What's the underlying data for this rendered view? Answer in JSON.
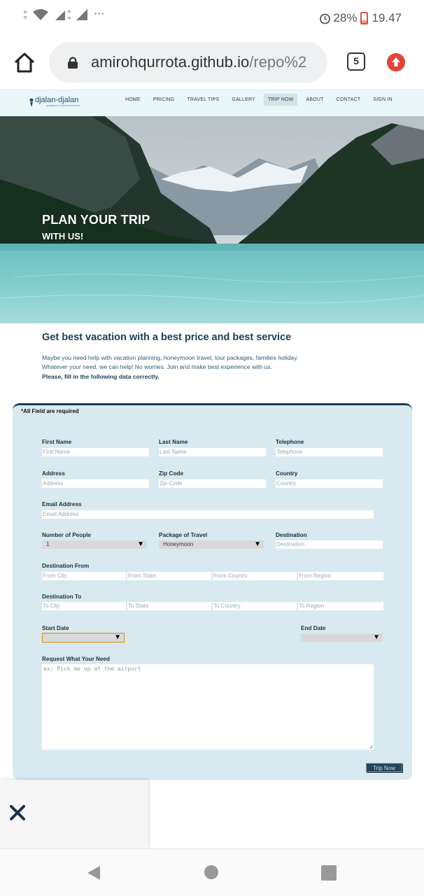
{
  "status_bar": {
    "battery": "28%",
    "time": "19.47",
    "more": "···"
  },
  "browser": {
    "url_main": "amirohqurrota.github.io",
    "url_rest": "/repo%2",
    "tab_count": "5"
  },
  "site": {
    "logo_text": "djalan-djalan",
    "logo_sub": "perjalanan & traveling bersama",
    "nav": [
      "HOME",
      "PRICING",
      "TRAVEL TIPS",
      "GALLERY",
      "TRIP NOW",
      "ABOUT",
      "CONTACT",
      "SIGN IN"
    ],
    "active_nav": "TRIP NOW"
  },
  "hero": {
    "title": "PLAN YOUR TRIP",
    "subtitle": "WITH US!"
  },
  "intro": {
    "heading": "Get best vacation with a best price and best service",
    "line1": "Maybe you need help with vacation planning, honeymoon travel, tour packages, families holiday.",
    "line2": "Whatever your need, we can help! No worries. Join and make best experience with us.",
    "line3": "Please, fill in the following data correctly."
  },
  "form": {
    "required_note": "*All Field are required",
    "first_name": {
      "label": "First Name",
      "placeholder": "First Name"
    },
    "last_name": {
      "label": "Last Name",
      "placeholder": "Last Name"
    },
    "telephone": {
      "label": "Telephone",
      "placeholder": "Telephone"
    },
    "address": {
      "label": "Address",
      "placeholder": "Address"
    },
    "zip": {
      "label": "Zip Code",
      "placeholder": "Zip Code"
    },
    "country": {
      "label": "Country",
      "placeholder": "Country"
    },
    "email": {
      "label": "Email Address",
      "placeholder": "Email Address"
    },
    "people": {
      "label": "Number of People",
      "value": "1"
    },
    "package": {
      "label": "Package of Travel",
      "value": "Honeymoon"
    },
    "destination": {
      "label": "Destination",
      "placeholder": "Destination"
    },
    "dest_from": {
      "label": "Destination From",
      "city": "From City",
      "state": "From State",
      "country": "From Country",
      "region": "From Region"
    },
    "dest_to": {
      "label": "Destination To",
      "city": "To City",
      "state": "To State",
      "country": "To Country",
      "region": "To Region"
    },
    "start_date": {
      "label": "Start Date"
    },
    "end_date": {
      "label": "End Date"
    },
    "request": {
      "label": "Request What Your Need",
      "placeholder": "ex: Pick me up at the airport"
    },
    "submit": "Trip Now"
  }
}
